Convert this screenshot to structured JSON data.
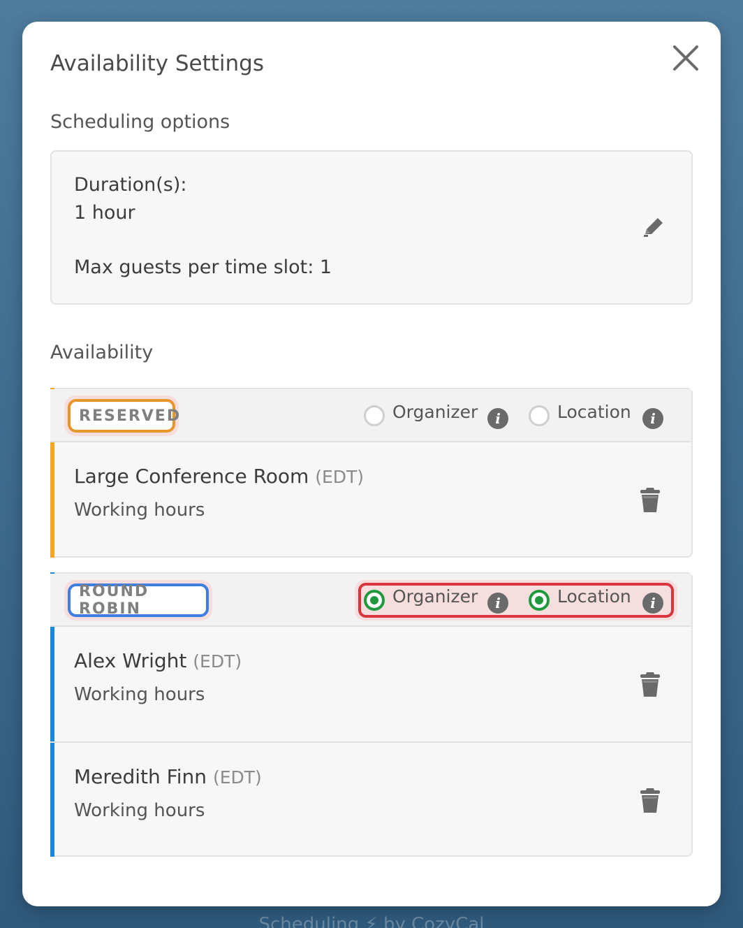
{
  "modal": {
    "title": "Availability Settings"
  },
  "scheduling": {
    "section_title": "Scheduling options",
    "duration_label": "Duration(s):",
    "duration_value": "1 hour",
    "max_guests": "Max guests per time slot: 1"
  },
  "availability": {
    "section_title": "Availability",
    "groups": [
      {
        "badge": "RESERVED",
        "accent": "#f5a623",
        "badge_border": "#e6962a",
        "organizer_label": "Organizer",
        "organizer_selected": false,
        "location_label": "Location",
        "location_selected": false,
        "members": [
          {
            "name": "Large Conference Room",
            "tz": "(EDT)",
            "hours": "Working hours"
          }
        ]
      },
      {
        "badge": "ROUND ROBIN",
        "accent": "#1a88d8",
        "badge_border": "#3d7ee0",
        "organizer_label": "Organizer",
        "organizer_selected": true,
        "location_label": "Location",
        "location_selected": true,
        "members": [
          {
            "name": "Alex Wright",
            "tz": "(EDT)",
            "hours": "Working hours"
          },
          {
            "name": "Meredith Finn",
            "tz": "(EDT)",
            "hours": "Working hours"
          }
        ]
      }
    ]
  },
  "footer": {
    "text": "Scheduling ⚡ by CozyCal"
  },
  "colors": {
    "selected_radio": "#1e9a3c",
    "highlight": "#d9353e"
  }
}
